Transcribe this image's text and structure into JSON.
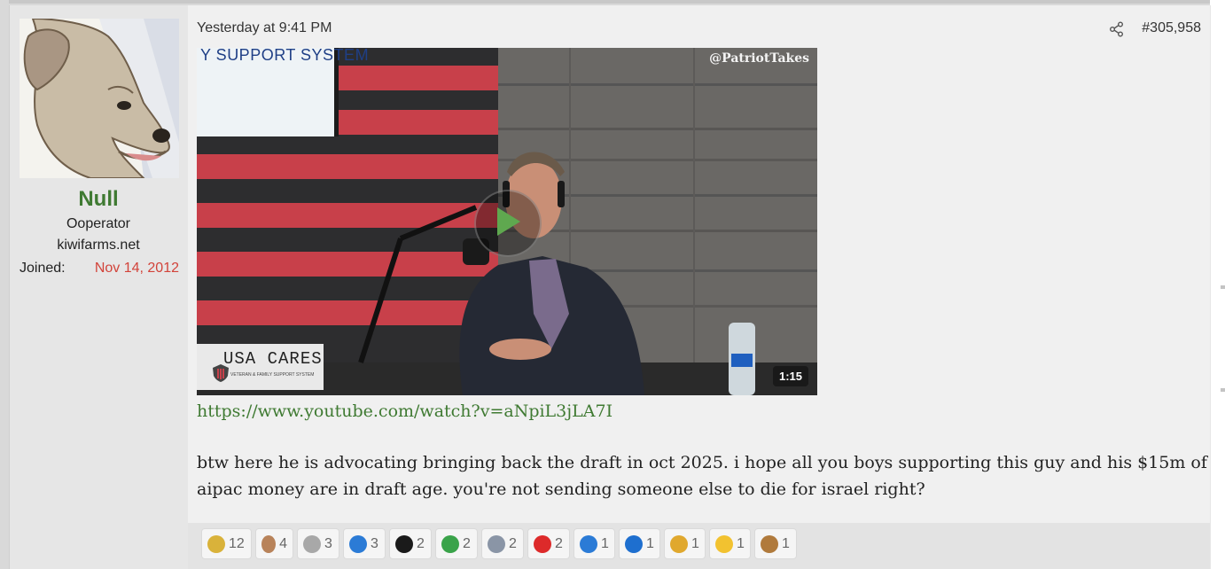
{
  "post": {
    "date": "Yesterday at 9:41 PM",
    "number": "#305,958",
    "link": "https://www.youtube.com/watch?v=aNpiL3jLA7I",
    "body": "btw here he is advocating bringing back the draft in oct 2025. i hope all you boys supporting this guy and his $15m of aipac money are in draft age. you're not sending someone else to die for israel right?"
  },
  "user": {
    "name": "Null",
    "title": "Ooperator",
    "site": "kiwifarms.net",
    "joined_label": "Joined:",
    "joined_value": "Nov 14, 2012"
  },
  "video": {
    "watermark": "@PatriotTakes",
    "duration": "1:15",
    "screen_text": "Y SUPPORT SYSTEM",
    "logo_title": "USA CARES",
    "logo_sub": "VETERAN & FAMILY SUPPORT SYSTEM"
  },
  "reactions": [
    {
      "name": "medal-icon",
      "count": "12",
      "color": "#d9b23a"
    },
    {
      "name": "face-icon",
      "count": "4",
      "color": "#b8835a"
    },
    {
      "name": "rock-icon",
      "count": "3",
      "color": "#a8a8a8"
    },
    {
      "name": "info-icon",
      "count": "3",
      "color": "#2b7bd6"
    },
    {
      "name": "top-hat-icon",
      "count": "2",
      "color": "#1a1a1a"
    },
    {
      "name": "check-icon",
      "count": "2",
      "color": "#3aa34a"
    },
    {
      "name": "wrench-icon",
      "count": "2",
      "color": "#8a95a6"
    },
    {
      "name": "heart-icon",
      "count": "2",
      "color": "#dd2a2a"
    },
    {
      "name": "thumbs-up-icon",
      "count": "1",
      "color": "#2b7bd6"
    },
    {
      "name": "star-of-david-icon",
      "count": "1",
      "color": "#1e6fcf"
    },
    {
      "name": "puzzle-icon",
      "count": "1",
      "color": "#e0a82e"
    },
    {
      "name": "thinking-face-icon",
      "count": "1",
      "color": "#f2c230"
    },
    {
      "name": "deer-icon",
      "count": "1",
      "color": "#b07a3c"
    }
  ]
}
